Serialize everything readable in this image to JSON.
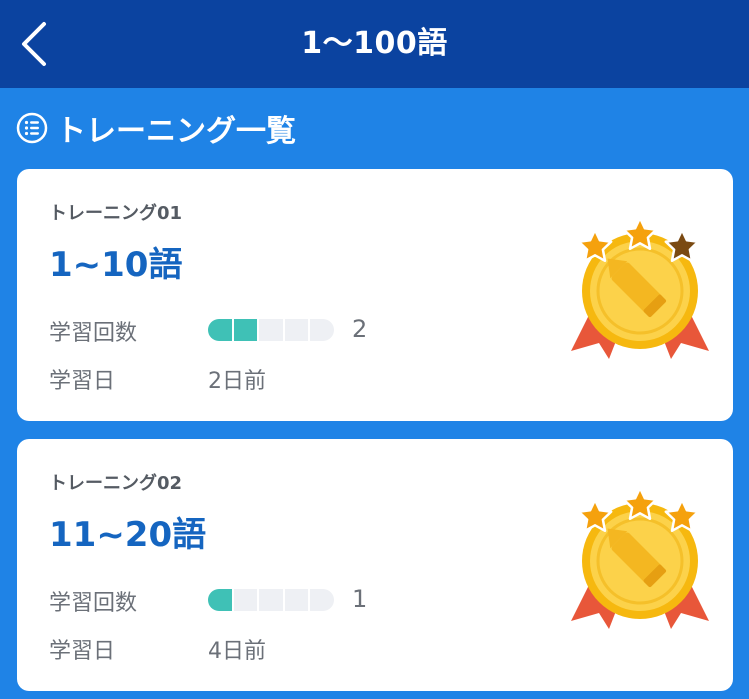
{
  "header": {
    "title": "1〜100語",
    "back_icon": "chevron-left-icon"
  },
  "section": {
    "icon": "list-icon",
    "title": "トレーニング一覧"
  },
  "colors": {
    "header_bg": "#0b43a0",
    "page_bg": "#1f83e6",
    "range_text": "#1565c0",
    "progress_filled": "#3fc1b6",
    "progress_empty": "#eef0f4",
    "star_earned": "#f5a10d",
    "star_unearned": "#7a4a12"
  },
  "trainings": [
    {
      "label": "トレーニング01",
      "range": "1~10語",
      "count_label": "学習回数",
      "count": "2",
      "progress_filled": 2,
      "progress_total": 5,
      "date_label": "学習日",
      "date": "2日前",
      "medal_icon": "gold-medal-icon",
      "stars_earned": 2,
      "stars_total": 3
    },
    {
      "label": "トレーニング02",
      "range": "11~20語",
      "count_label": "学習回数",
      "count": "1",
      "progress_filled": 1,
      "progress_total": 5,
      "date_label": "学習日",
      "date": "4日前",
      "medal_icon": "gold-medal-icon",
      "stars_earned": 3,
      "stars_total": 3
    }
  ]
}
